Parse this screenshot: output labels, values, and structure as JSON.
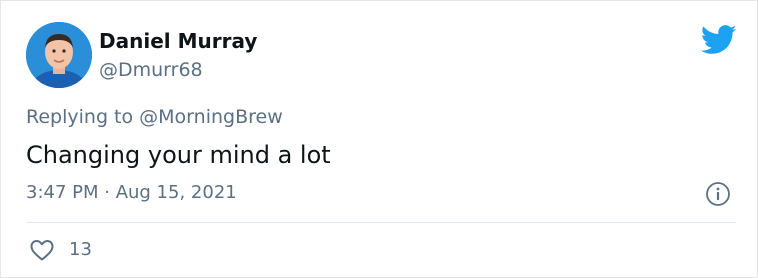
{
  "author": {
    "display_name": "Daniel Murray",
    "handle": "@Dmurr68",
    "avatar_icon": "profile-photo"
  },
  "reply": {
    "prefix": "Replying to ",
    "mention": "@MorningBrew"
  },
  "tweet": {
    "text": "Changing your mind a lot",
    "timestamp": "3:47 PM · Aug 15, 2021"
  },
  "engagement": {
    "likes": "13",
    "like_icon": "heart-outline"
  },
  "icons": {
    "brand": "twitter-bird",
    "info": "info-circle"
  },
  "colors": {
    "twitter_blue": "#1da1f2",
    "secondary_text": "#5b7083",
    "primary_text": "#0f1419"
  }
}
